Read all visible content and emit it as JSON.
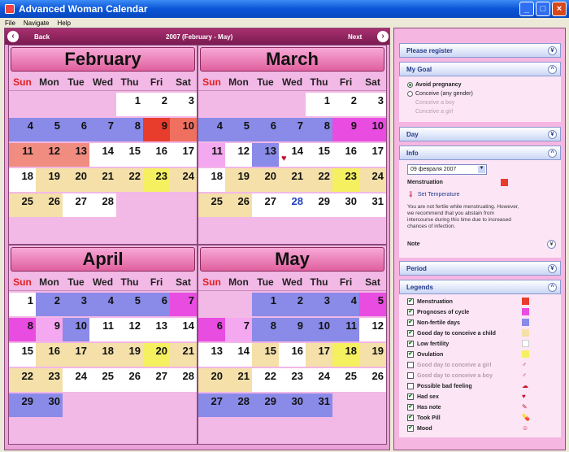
{
  "window": {
    "title": "Advanced Woman Calendar"
  },
  "menu": [
    "File",
    "Navigate",
    "Help"
  ],
  "nav": {
    "back": "Back",
    "center": "2007 (February - May)",
    "next": "Next"
  },
  "dow": [
    "Sun",
    "Mon",
    "Tue",
    "Wed",
    "Thu",
    "Fri",
    "Sat"
  ],
  "months": [
    {
      "name": "February",
      "days": [
        {
          "d": "",
          "c": ""
        },
        {
          "d": "",
          "c": ""
        },
        {
          "d": "",
          "c": ""
        },
        {
          "d": "",
          "c": ""
        },
        {
          "d": "1",
          "c": "#ffffff"
        },
        {
          "d": "2",
          "c": "#ffffff"
        },
        {
          "d": "3",
          "c": "#ffffff"
        },
        {
          "d": "4",
          "c": "#8a8ae8"
        },
        {
          "d": "5",
          "c": "#8a8ae8"
        },
        {
          "d": "6",
          "c": "#8a8ae8"
        },
        {
          "d": "7",
          "c": "#8a8ae8"
        },
        {
          "d": "8",
          "c": "#8a8ae8"
        },
        {
          "d": "9",
          "c": "#e83c2c"
        },
        {
          "d": "10",
          "c": "#f07060"
        },
        {
          "d": "11",
          "c": "#f08c80"
        },
        {
          "d": "12",
          "c": "#f08c80"
        },
        {
          "d": "13",
          "c": "#f08c80"
        },
        {
          "d": "14",
          "c": "#ffffff"
        },
        {
          "d": "15",
          "c": "#ffffff"
        },
        {
          "d": "16",
          "c": "#ffffff"
        },
        {
          "d": "17",
          "c": "#ffffff"
        },
        {
          "d": "18",
          "c": "#ffffff"
        },
        {
          "d": "19",
          "c": "#f4e0a8"
        },
        {
          "d": "20",
          "c": "#f4e0a8"
        },
        {
          "d": "21",
          "c": "#f4e0a8"
        },
        {
          "d": "22",
          "c": "#f4e0a8"
        },
        {
          "d": "23",
          "c": "#f4f060"
        },
        {
          "d": "24",
          "c": "#f4e0a8"
        },
        {
          "d": "25",
          "c": "#f4e0a8"
        },
        {
          "d": "26",
          "c": "#f4e0a8"
        },
        {
          "d": "27",
          "c": "#ffffff"
        },
        {
          "d": "28",
          "c": "#ffffff"
        },
        {
          "d": "",
          "c": ""
        },
        {
          "d": "",
          "c": ""
        },
        {
          "d": "",
          "c": ""
        }
      ]
    },
    {
      "name": "March",
      "days": [
        {
          "d": "",
          "c": ""
        },
        {
          "d": "",
          "c": ""
        },
        {
          "d": "",
          "c": ""
        },
        {
          "d": "",
          "c": ""
        },
        {
          "d": "1",
          "c": "#ffffff"
        },
        {
          "d": "2",
          "c": "#ffffff"
        },
        {
          "d": "3",
          "c": "#ffffff"
        },
        {
          "d": "4",
          "c": "#8a8ae8"
        },
        {
          "d": "5",
          "c": "#8a8ae8"
        },
        {
          "d": "6",
          "c": "#8a8ae8"
        },
        {
          "d": "7",
          "c": "#8a8ae8"
        },
        {
          "d": "8",
          "c": "#8a8ae8"
        },
        {
          "d": "9",
          "c": "#e84ce0"
        },
        {
          "d": "10",
          "c": "#e84ce0"
        },
        {
          "d": "11",
          "c": "#f4a8f0"
        },
        {
          "d": "12",
          "c": "#ffffff"
        },
        {
          "d": "13",
          "c": "#8a8ae8"
        },
        {
          "d": "14",
          "c": "#ffffff",
          "ic": "♥"
        },
        {
          "d": "15",
          "c": "#ffffff"
        },
        {
          "d": "16",
          "c": "#ffffff"
        },
        {
          "d": "17",
          "c": "#ffffff"
        },
        {
          "d": "18",
          "c": "#ffffff"
        },
        {
          "d": "19",
          "c": "#f4e0a8"
        },
        {
          "d": "20",
          "c": "#f4e0a8"
        },
        {
          "d": "21",
          "c": "#f4e0a8"
        },
        {
          "d": "22",
          "c": "#f4e0a8"
        },
        {
          "d": "23",
          "c": "#f4f060"
        },
        {
          "d": "24",
          "c": "#f4e0a8"
        },
        {
          "d": "25",
          "c": "#f4e0a8"
        },
        {
          "d": "26",
          "c": "#f4e0a8"
        },
        {
          "d": "27",
          "c": "#ffffff"
        },
        {
          "d": "28",
          "c": "#ffffff",
          "blue": true
        },
        {
          "d": "29",
          "c": "#ffffff"
        },
        {
          "d": "30",
          "c": "#ffffff"
        },
        {
          "d": "31",
          "c": "#ffffff"
        }
      ]
    },
    {
      "name": "April",
      "days": [
        {
          "d": "1",
          "c": "#ffffff"
        },
        {
          "d": "2",
          "c": "#8a8ae8"
        },
        {
          "d": "3",
          "c": "#8a8ae8"
        },
        {
          "d": "4",
          "c": "#8a8ae8"
        },
        {
          "d": "5",
          "c": "#8a8ae8"
        },
        {
          "d": "6",
          "c": "#8a8ae8"
        },
        {
          "d": "7",
          "c": "#e84ce0"
        },
        {
          "d": "8",
          "c": "#e84ce0"
        },
        {
          "d": "9",
          "c": "#f4a8f0"
        },
        {
          "d": "10",
          "c": "#8a8ae8"
        },
        {
          "d": "11",
          "c": "#ffffff"
        },
        {
          "d": "12",
          "c": "#ffffff"
        },
        {
          "d": "13",
          "c": "#ffffff"
        },
        {
          "d": "14",
          "c": "#ffffff"
        },
        {
          "d": "15",
          "c": "#ffffff"
        },
        {
          "d": "16",
          "c": "#f4e0a8"
        },
        {
          "d": "17",
          "c": "#f4e0a8"
        },
        {
          "d": "18",
          "c": "#f4e0a8"
        },
        {
          "d": "19",
          "c": "#f4e0a8"
        },
        {
          "d": "20",
          "c": "#f4f060"
        },
        {
          "d": "21",
          "c": "#f4e0a8"
        },
        {
          "d": "22",
          "c": "#f4e0a8"
        },
        {
          "d": "23",
          "c": "#f4e0a8"
        },
        {
          "d": "24",
          "c": "#ffffff"
        },
        {
          "d": "25",
          "c": "#ffffff"
        },
        {
          "d": "26",
          "c": "#ffffff"
        },
        {
          "d": "27",
          "c": "#ffffff"
        },
        {
          "d": "28",
          "c": "#ffffff"
        },
        {
          "d": "29",
          "c": "#8a8ae8"
        },
        {
          "d": "30",
          "c": "#8a8ae8"
        },
        {
          "d": "",
          "c": ""
        },
        {
          "d": "",
          "c": ""
        },
        {
          "d": "",
          "c": ""
        },
        {
          "d": "",
          "c": ""
        },
        {
          "d": "",
          "c": ""
        }
      ]
    },
    {
      "name": "May",
      "days": [
        {
          "d": "",
          "c": ""
        },
        {
          "d": "",
          "c": ""
        },
        {
          "d": "1",
          "c": "#8a8ae8"
        },
        {
          "d": "2",
          "c": "#8a8ae8"
        },
        {
          "d": "3",
          "c": "#8a8ae8"
        },
        {
          "d": "4",
          "c": "#8a8ae8"
        },
        {
          "d": "5",
          "c": "#e84ce0"
        },
        {
          "d": "6",
          "c": "#e84ce0"
        },
        {
          "d": "7",
          "c": "#f4a8f0"
        },
        {
          "d": "8",
          "c": "#8a8ae8"
        },
        {
          "d": "9",
          "c": "#8a8ae8"
        },
        {
          "d": "10",
          "c": "#8a8ae8"
        },
        {
          "d": "11",
          "c": "#8a8ae8"
        },
        {
          "d": "12",
          "c": "#ffffff"
        },
        {
          "d": "13",
          "c": "#ffffff"
        },
        {
          "d": "14",
          "c": "#ffffff"
        },
        {
          "d": "15",
          "c": "#f4e0a8"
        },
        {
          "d": "16",
          "c": "#ffffff"
        },
        {
          "d": "17",
          "c": "#f4e0a8"
        },
        {
          "d": "18",
          "c": "#f4f060"
        },
        {
          "d": "19",
          "c": "#f4e0a8"
        },
        {
          "d": "20",
          "c": "#f4e0a8"
        },
        {
          "d": "21",
          "c": "#f4e0a8"
        },
        {
          "d": "22",
          "c": "#ffffff"
        },
        {
          "d": "23",
          "c": "#ffffff"
        },
        {
          "d": "24",
          "c": "#ffffff"
        },
        {
          "d": "25",
          "c": "#ffffff"
        },
        {
          "d": "26",
          "c": "#ffffff"
        },
        {
          "d": "27",
          "c": "#8a8ae8"
        },
        {
          "d": "28",
          "c": "#8a8ae8"
        },
        {
          "d": "29",
          "c": "#8a8ae8"
        },
        {
          "d": "30",
          "c": "#8a8ae8"
        },
        {
          "d": "31",
          "c": "#8a8ae8"
        },
        {
          "d": "",
          "c": ""
        },
        {
          "d": "",
          "c": ""
        }
      ]
    }
  ],
  "panel": {
    "register": "Please register",
    "goal": {
      "title": "My Goal",
      "options": [
        "Avoid pregnancy",
        "Conceive (any gender)",
        "Conceive a boy",
        "Conceive a girl"
      ]
    },
    "day": "Day",
    "info": {
      "title": "Info",
      "date": "09 февраля 2007",
      "menstruation": "Menstruation",
      "set_temp": "Set Temperature",
      "text": "You are not fertile while menstruating. However, we recommend that you abstain from intercourse during this time due to increased chances of infection.",
      "note": "Note"
    },
    "period": "Period",
    "legends": {
      "title": "Legends",
      "items": [
        {
          "label": "Menstruation",
          "color": "#e83c2c",
          "checked": true
        },
        {
          "label": "Prognoses of cycle",
          "color": "#e84ce0",
          "checked": true
        },
        {
          "label": "Non-fertile days",
          "color": "#8a8ae8",
          "checked": true
        },
        {
          "label": "Good day to conceive a child",
          "color": "#f4e0a8",
          "checked": true
        },
        {
          "label": "Low fertility",
          "color": "#ffffff",
          "checked": true
        },
        {
          "label": "Ovulation",
          "color": "#f4f060",
          "checked": true
        },
        {
          "label": "Good day to conceive a girl",
          "color": "",
          "checked": false,
          "dim": true
        },
        {
          "label": "Good day to conceive a boy",
          "color": "",
          "checked": false,
          "dim": true
        },
        {
          "label": "Possible bad feeling",
          "color": "",
          "checked": false
        },
        {
          "label": "Had sex",
          "color": "",
          "checked": true
        },
        {
          "label": "Has note",
          "color": "",
          "checked": true
        },
        {
          "label": "Took Pill",
          "color": "",
          "checked": true
        },
        {
          "label": "Mood",
          "color": "",
          "checked": true
        }
      ]
    }
  }
}
